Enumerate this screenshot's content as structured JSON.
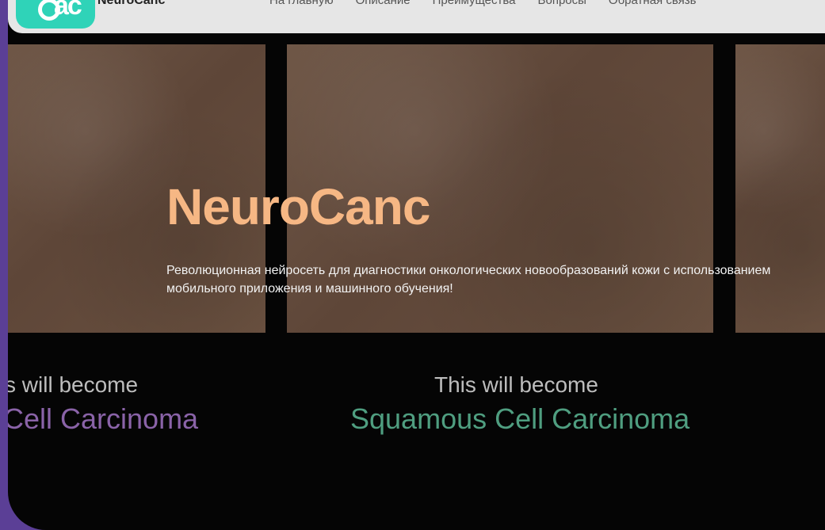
{
  "navbar": {
    "brand": "NeuroCanc",
    "logo_letters": "ac",
    "links": [
      "На главную",
      "Описание",
      "Преимущества",
      "Вопросы",
      "Обратная связь"
    ]
  },
  "hero": {
    "title": "NeuroCanc",
    "subtitle": "Революционная нейросеть для диагностики онкологических новообразований кожи с использованием мобильного приложения и машинного обучения!"
  },
  "captions": {
    "left_line1": "s will become",
    "left_line2": "Cell Carcinoma",
    "middle_line1": "This will become",
    "middle_line2": "Squamous Cell Carcinoma"
  },
  "colors": {
    "accent_title": "#f6b784",
    "logo_teal": "#2fd3b8",
    "caption_purple": "#8a63a8",
    "caption_green": "#4f9e80",
    "outer_background": "#5b3f96"
  }
}
